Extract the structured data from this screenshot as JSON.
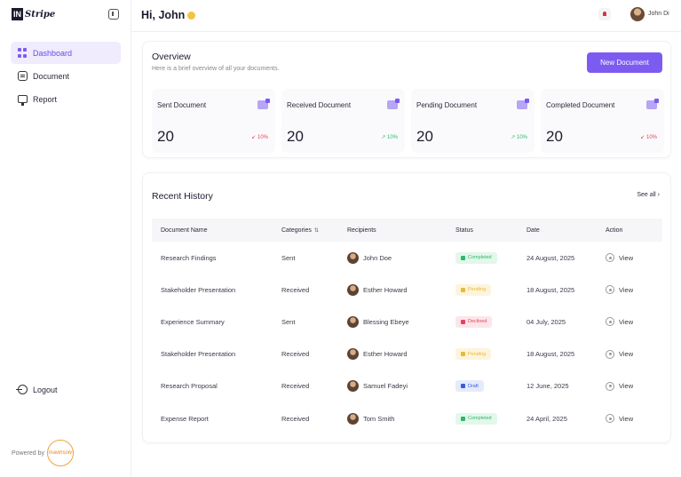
{
  "sidebar": {
    "logo_box": "IN",
    "logo_text": "Stripe",
    "items": [
      {
        "label": "Dashboard",
        "icon": "grid-icon",
        "active": true
      },
      {
        "label": "Document",
        "icon": "document-icon",
        "active": false
      },
      {
        "label": "Report",
        "icon": "report-icon",
        "active": false
      }
    ],
    "logout_label": "Logout",
    "powered_by": "Powered by",
    "powered_brand": "mavinsolv"
  },
  "header": {
    "greeting": "Hi, John",
    "user_name": "John Di"
  },
  "overview": {
    "title": "Overview",
    "subtitle": "Here is a brief overview of all your documents.",
    "new_button": "New Document",
    "stats": [
      {
        "label": "Sent Document",
        "value": "20",
        "trend": "↙ 10%",
        "direction": "down"
      },
      {
        "label": "Received Document",
        "value": "20",
        "trend": "↗ 10%",
        "direction": "up"
      },
      {
        "label": "Pending Document",
        "value": "20",
        "trend": "↗ 10%",
        "direction": "up"
      },
      {
        "label": "Completed Document",
        "value": "20",
        "trend": "↙ 10%",
        "direction": "down"
      }
    ]
  },
  "history": {
    "title": "Recent History",
    "see_all": "See all ›",
    "columns": [
      "Document Name",
      "Categories",
      "Recipients",
      "Status",
      "Date",
      "Action"
    ],
    "sort_icon": "⇅",
    "rows": [
      {
        "name": "Research Findings",
        "category": "Sent",
        "recipient": "John Doe",
        "status": "Completed",
        "status_key": "completed",
        "date": "24 August, 2025",
        "action": "View"
      },
      {
        "name": "Stakeholder Presentation",
        "category": "Received",
        "recipient": "Esther Howard",
        "status": "Pending",
        "status_key": "pending",
        "date": "18 August, 2025",
        "action": "View"
      },
      {
        "name": "Experience Summary",
        "category": "Sent",
        "recipient": "Blessing Ebeye",
        "status": "Declined",
        "status_key": "declined",
        "date": "04 July, 2025",
        "action": "View"
      },
      {
        "name": "Stakeholder Presentation",
        "category": "Received",
        "recipient": "Esther Howard",
        "status": "Pending",
        "status_key": "pending",
        "date": "18 August, 2025",
        "action": "View"
      },
      {
        "name": "Research Proposal",
        "category": "Received",
        "recipient": "Samuel Fadeyi",
        "status": "Draft",
        "status_key": "draft",
        "date": "12 June, 2025",
        "action": "View"
      },
      {
        "name": "Expense Report",
        "category": "Received",
        "recipient": "Tom Smith",
        "status": "Completed",
        "status_key": "completed",
        "date": "24 April, 2025",
        "action": "View"
      }
    ]
  },
  "colors": {
    "accent": "#7c5cf0",
    "completed": "#2db86a",
    "pending": "#e9b93a",
    "declined": "#e0455c",
    "draft": "#3a5cd6"
  }
}
